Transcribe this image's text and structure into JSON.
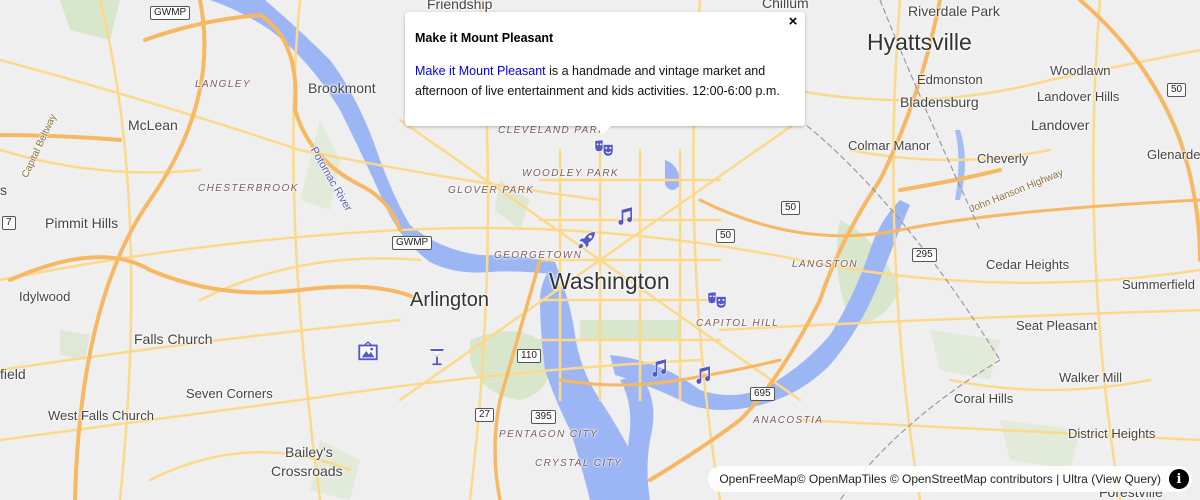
{
  "popup": {
    "title": "Make it Mount Pleasant",
    "link_text": "Make it Mount Pleasant",
    "description": " is a handmade and vintage market and afternoon of live entertainment and kids activities. 12:00-6:00 p.m.",
    "close_label": "×"
  },
  "attribution": {
    "text": "OpenFreeMap© OpenMapTiles © OpenStreetMap contributors | Ultra (View Query)",
    "info_label": "i"
  },
  "colors": {
    "land": "#efefef",
    "water": "#9cb6f5",
    "park": "#d8e6cc",
    "road": "#fcd98a",
    "highway": "#f7b863",
    "poi": "#5558c5"
  },
  "labels": {
    "cities": {
      "washington": "Washington",
      "arlington": "Arlington",
      "hyattsville": "Hyattsville"
    },
    "towns": {
      "friendship": "Friendship",
      "chillum": "Chillum",
      "riverdale_park": "Riverdale Park",
      "brookmont": "Brookmont",
      "mclean": "McLean",
      "edmonston": "Edmonston",
      "bladensburg": "Bladensburg",
      "woodlawn": "Woodlawn",
      "landover_hills": "Landover Hills",
      "landover": "Landover",
      "colmar_manor": "Colmar Manor",
      "cheverly": "Cheverly",
      "glenarden": "Glenarde",
      "pimmit_hills": "Pimmit Hills",
      "idylwood": "Idylwood",
      "falls_church": "Falls Church",
      "west_falls_church": "West Falls Church",
      "seven_corners": "Seven Corners",
      "baileys_crossroads_1": "Bailey's",
      "baileys_crossroads_2": "Crossroads",
      "cedar_heights": "Cedar Heights",
      "summerfield": "Summerfield",
      "seat_pleasant": "Seat Pleasant",
      "walker_mill": "Walker Mill",
      "coral_hills": "Coral Hills",
      "district_heights": "District Heights",
      "forestville": "Forestville",
      "field": "field",
      "s_edge": "s"
    },
    "neighborhoods": {
      "langley": "Langley",
      "chesterbrook": "Chesterbrook",
      "cleveland_park": "Cleveland Park",
      "woodley_park": "Woodley Park",
      "glover_park": "Glover Park",
      "georgetown": "Georgetown",
      "langston": "Langston",
      "capitol_hill": "Capitol Hill",
      "anacostia": "Anacostia",
      "pentagon_city": "Pentagon City",
      "crystal_city": "Crystal City"
    },
    "water": {
      "potomac": "Potomac River"
    },
    "roads": {
      "capital_beltway": "Capital Beltway",
      "john_hanson": "John Hanson Highway"
    },
    "shields": {
      "gwmp_top": "GWMP",
      "gwmp_mid": "GWMP",
      "us50_east": "50",
      "us50_a": "50",
      "us50_b": "50",
      "i295": "295",
      "va110": "110",
      "va27": "27",
      "i395": "395",
      "i695": "695",
      "va7": "7"
    }
  },
  "markers": [
    {
      "name": "theater-marker-mount-pleasant",
      "icon": "theater-masks-icon"
    },
    {
      "name": "music-marker-dupont",
      "icon": "music-note-icon"
    },
    {
      "name": "rocket-marker",
      "icon": "rocket-icon"
    },
    {
      "name": "theater-marker-capitol-hill",
      "icon": "theater-masks-icon"
    },
    {
      "name": "gallery-marker",
      "icon": "picture-icon"
    },
    {
      "name": "cocktail-marker",
      "icon": "cocktail-icon"
    },
    {
      "name": "music-marker-wharf",
      "icon": "music-note-icon"
    },
    {
      "name": "music-marker-navy-yard",
      "icon": "music-note-icon"
    }
  ]
}
